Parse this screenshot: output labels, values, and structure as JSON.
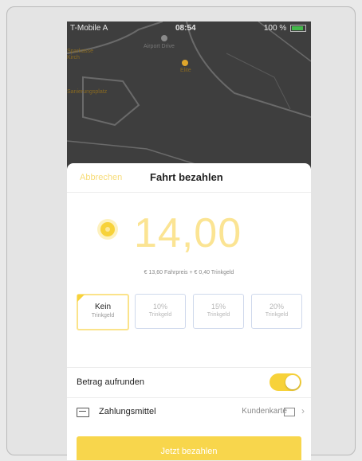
{
  "status_bar": {
    "carrier": "T-Mobile A",
    "time": "08:54",
    "battery_text": "100 %"
  },
  "map": {
    "labels": [
      "Airport Drive",
      "Elite",
      "Sparkasse Kirch",
      "Sanierungsplatz"
    ],
    "accent_colors": {
      "poi": "#e0a72b",
      "road": "#6a6a6a"
    }
  },
  "header": {
    "cancel_label": "Abbrechen",
    "title": "Fahrt bezahlen"
  },
  "amount": {
    "value": "14,00",
    "breakdown": "€ 13,60 Fahrpreis + € 0,40 Trinkgeld"
  },
  "tips": [
    {
      "pct": "Kein",
      "label": "Trinkgeld",
      "selected": true
    },
    {
      "pct": "10%",
      "label": "Trinkgeld",
      "selected": false
    },
    {
      "pct": "15%",
      "label": "Trinkgeld",
      "selected": false
    },
    {
      "pct": "20%",
      "label": "Trinkgeld",
      "selected": false
    }
  ],
  "round_up": {
    "label": "Betrag aufrunden",
    "enabled": true
  },
  "payment": {
    "label": "Zahlungsmittel",
    "value": "Kundenkarte"
  },
  "cta": {
    "label": "Jetzt bezahlen"
  },
  "colors": {
    "accent": "#f7d23a",
    "accent_light": "#fbe493",
    "tip_border": "#cfd9ec"
  }
}
